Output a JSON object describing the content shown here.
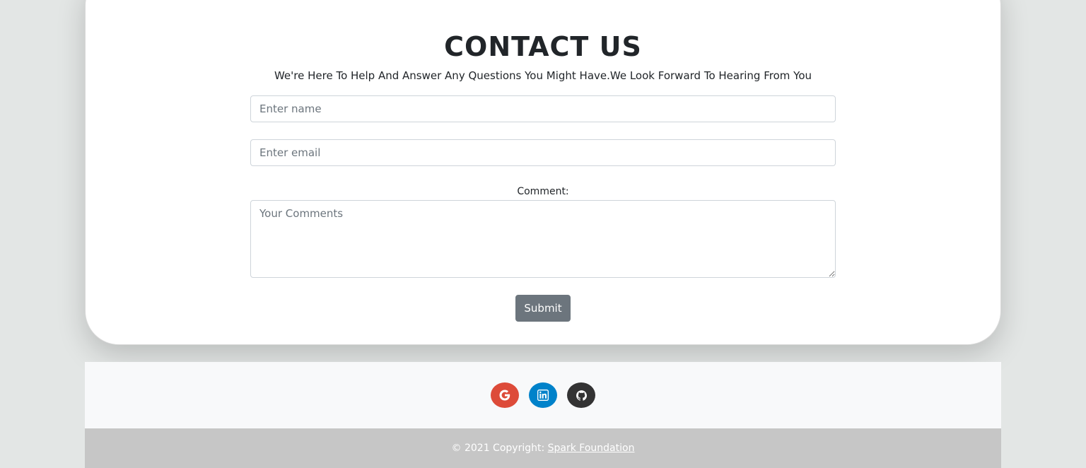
{
  "contact": {
    "title": "CONTACT US",
    "subtitle": "We're Here To Help And Answer Any Questions You Might Have.We Look Forward To Hearing From You",
    "name_placeholder": "Enter name",
    "email_placeholder": "Enter email",
    "comment_label": "Comment:",
    "comment_placeholder": "Your Comments",
    "submit_label": "Submit"
  },
  "social": {
    "items": [
      {
        "icon": "google-icon",
        "color": "#dd4b39"
      },
      {
        "icon": "linkedin-icon",
        "color": "#0082ca"
      },
      {
        "icon": "github-icon",
        "color": "#333333"
      }
    ]
  },
  "footer": {
    "copyright": "© 2021 Copyright: ",
    "link_text": "Spark Foundation"
  }
}
